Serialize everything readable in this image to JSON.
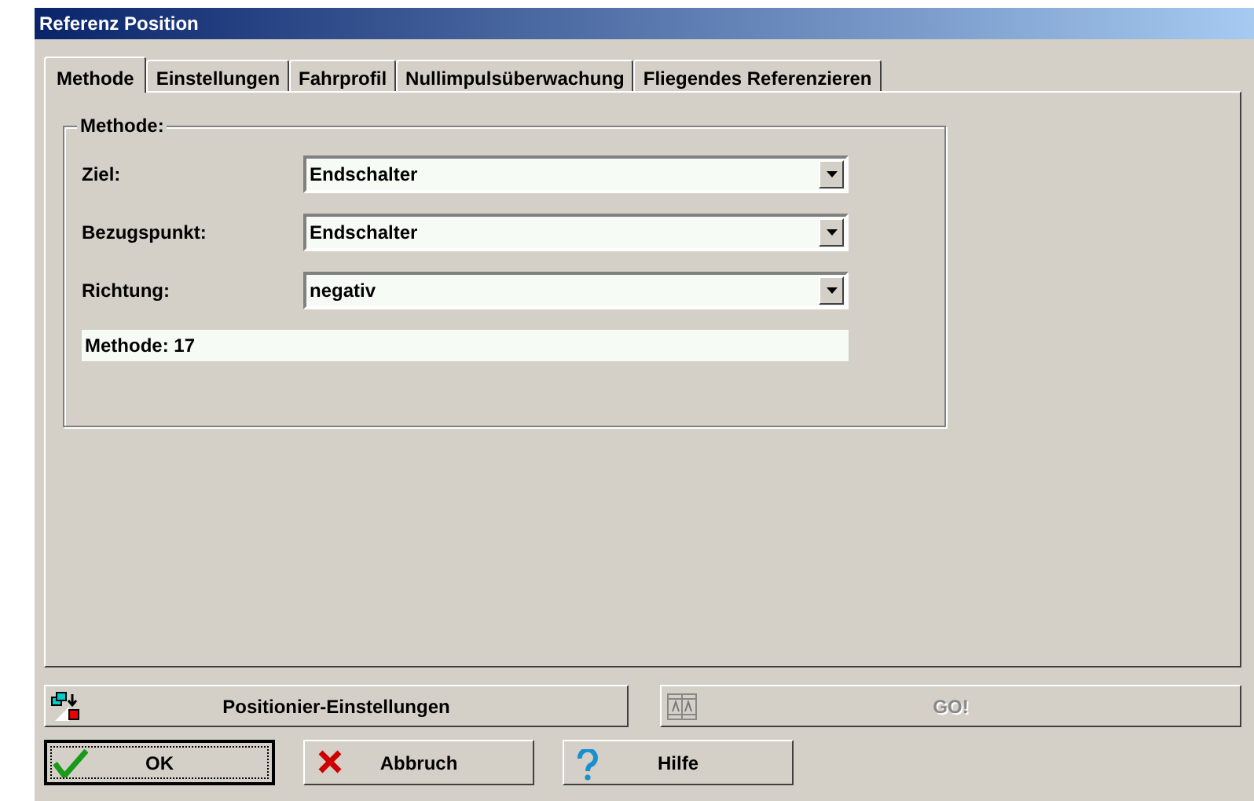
{
  "window": {
    "title": "Referenz Position"
  },
  "tabs": [
    {
      "label": "Methode",
      "selected": true
    },
    {
      "label": "Einstellungen",
      "selected": false
    },
    {
      "label": "Fahrprofil",
      "selected": false
    },
    {
      "label": "Nullimpulsüberwachung",
      "selected": false
    },
    {
      "label": "Fliegendes Referenzieren",
      "selected": false
    }
  ],
  "group": {
    "title": "Methode:",
    "fields": [
      {
        "label": "Ziel:",
        "value": "Endschalter"
      },
      {
        "label": "Bezugspunkt:",
        "value": "Endschalter"
      },
      {
        "label": "Richtung:",
        "value": "negativ"
      }
    ],
    "status": "Methode: 17"
  },
  "action_buttons": [
    {
      "label": "Positionier-Einstellungen",
      "kind": "settings",
      "disabled": false
    },
    {
      "label": "GO!",
      "kind": "go",
      "disabled": true
    }
  ],
  "buttons": [
    {
      "label": "OK",
      "kind": "ok",
      "default": true
    },
    {
      "label": "Abbruch",
      "kind": "cancel",
      "default": false
    },
    {
      "label": "Hilfe",
      "kind": "help",
      "default": false
    }
  ]
}
